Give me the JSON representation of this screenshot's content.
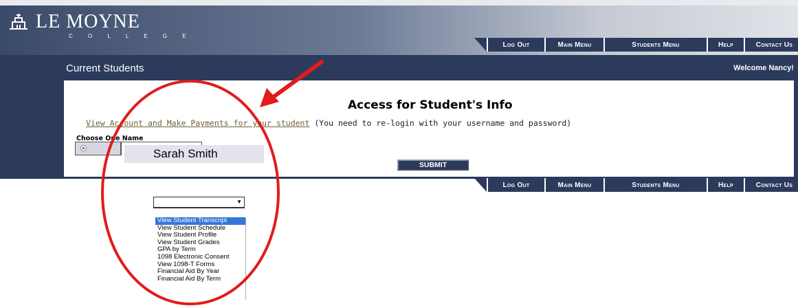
{
  "header": {
    "logo": {
      "text": "LE MOYNE",
      "sub": "C O L L E G E"
    },
    "nav": [
      "Log Out",
      "Main Menu",
      "Students Menu",
      "Help",
      "Contact Us"
    ]
  },
  "subheader": {
    "title": "Current Students",
    "welcome": "Welcome Nancy!"
  },
  "panel": {
    "heading": "Access for Student's Info",
    "link": "View Account and Make Payments for your student",
    "note": " (You need to re-login with your username and password)",
    "choose_label": "Choose One Name",
    "student_name": "Sarah Smith",
    "submit": "SUBMIT"
  },
  "dropdown": {
    "selected_value": "",
    "options": [
      "View Student Transcript",
      "View Student Schedule",
      "View Student Profile",
      "View Student Grades",
      "GPA by Term",
      "1098 Electronic Consent",
      "View 1098-T Forms",
      "Financial Aid By Year",
      "Financial Aid By Term"
    ],
    "highlighted_index": 0
  },
  "colors": {
    "navy": "#2c3a5c",
    "highlight": "#3478d8",
    "annotation": "#e21b1b"
  }
}
